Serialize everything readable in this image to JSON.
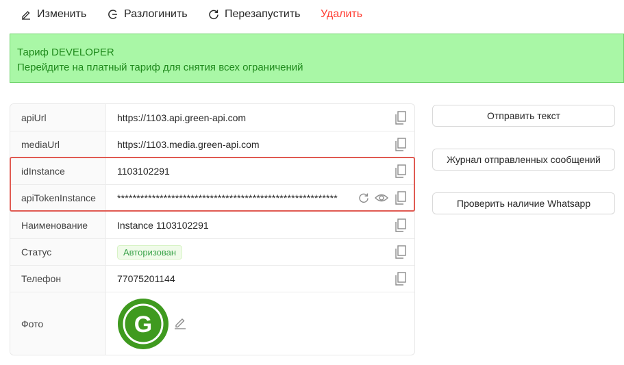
{
  "toolbar": {
    "edit_label": "Изменить",
    "logout_label": "Разлогинить",
    "restart_label": "Перезапустить",
    "delete_label": "Удалить"
  },
  "banner": {
    "title": "Тариф DEVELOPER",
    "text": "Перейдите на платный тариф для снятия всех ограничений"
  },
  "info": {
    "rows": [
      {
        "label": "apiUrl",
        "value": "https://1103.api.green-api.com"
      },
      {
        "label": "mediaUrl",
        "value": "https://1103.media.green-api.com"
      },
      {
        "label": "idInstance",
        "value": "1103102291"
      },
      {
        "label": "apiTokenInstance",
        "value": "*********************************************************"
      },
      {
        "label": "Наименование",
        "value": "Instance 1103102291"
      },
      {
        "label": "Статус",
        "value": "Авторизован"
      },
      {
        "label": "Телефон",
        "value": "77075201144"
      },
      {
        "label": "Фото",
        "value": ""
      }
    ],
    "avatar_letter": "G"
  },
  "actions": {
    "send_text": "Отправить текст",
    "journal": "Журнал отправленных сообщений",
    "check_whatsapp": "Проверить наличие Whatsapp"
  },
  "colors": {
    "banner_bg": "#a9f7a6",
    "banner_text": "#1f8a1c",
    "danger": "#ff3b30",
    "highlight": "#e05a52",
    "status_green": "#3aa34a",
    "avatar_green": "#3f9a1f"
  },
  "icons": [
    "pencil-icon",
    "logout-icon",
    "refresh-icon",
    "copy-icon",
    "eye-icon"
  ]
}
